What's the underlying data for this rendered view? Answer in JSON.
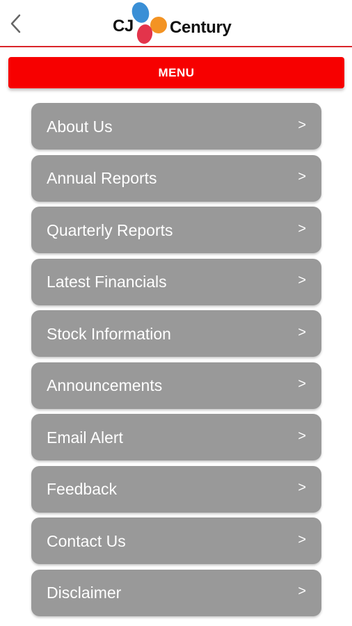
{
  "header": {
    "back_icon": "chevron-left-icon",
    "logo": {
      "mark": "CJ",
      "name": "Century",
      "colors": {
        "blue": "#3a8fd6",
        "orange": "#f39323",
        "red": "#e3344b"
      }
    },
    "accent_color": "#d9252a"
  },
  "menu_bar": {
    "title": "MENU",
    "color": "#f70000"
  },
  "menu": {
    "items": [
      {
        "label": "About Us",
        "arrow": ">"
      },
      {
        "label": "Annual Reports",
        "arrow": ">"
      },
      {
        "label": "Quarterly Reports",
        "arrow": ">"
      },
      {
        "label": "Latest Financials",
        "arrow": ">"
      },
      {
        "label": "Stock Information",
        "arrow": ">"
      },
      {
        "label": "Announcements",
        "arrow": ">"
      },
      {
        "label": "Email Alert",
        "arrow": ">"
      },
      {
        "label": "Feedback",
        "arrow": ">"
      },
      {
        "label": "Contact Us",
        "arrow": ">"
      },
      {
        "label": "Disclaimer",
        "arrow": ">"
      }
    ],
    "item_color": "#999999"
  }
}
